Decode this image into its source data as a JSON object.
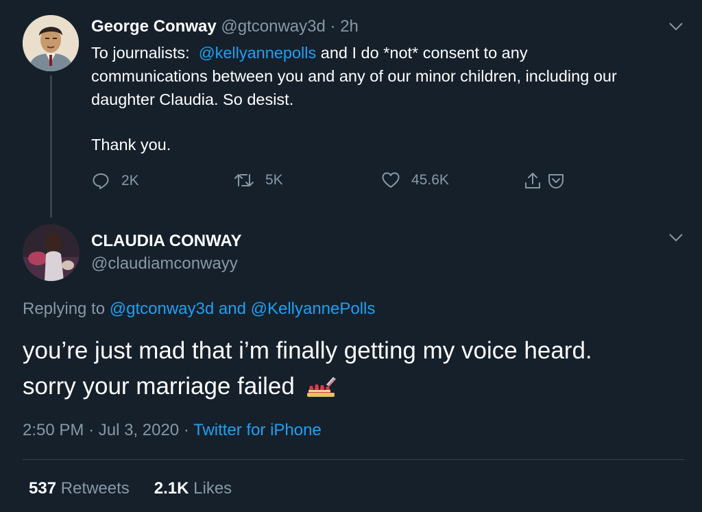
{
  "tweet1": {
    "author_name": "George Conway",
    "author_handle": "@gtconway3d",
    "separator": "·",
    "time": "2h",
    "text_line1_prefix": "To journalists:",
    "mention": "@kellyannepolls",
    "text_line1_suffix": "and I do *not* consent to any",
    "text_line2": "communications between you and any of our minor children, including our",
    "text_line3": "daughter Claudia.  So desist.",
    "text_line4": "Thank you.",
    "replies": "2K",
    "retweets": "5K",
    "likes": "45.6K"
  },
  "tweet2": {
    "author_name": "CLAUDIA CONWAY",
    "author_handle": "@claudiamconwayy",
    "replying_label": "Replying to",
    "replying_user1": "@gtconway3d",
    "replying_and": "and",
    "replying_user2": "@KellyannePolls",
    "text_line1": "you’re just mad that i’m finally getting my voice heard.",
    "text_line2": "sorry your marriage failed",
    "emoji": "lipstick-icon",
    "time": "2:50 PM",
    "date_separator": "·",
    "date": "Jul 3, 2020",
    "source_separator": "·",
    "source": "Twitter for iPhone",
    "retweet_count": "537",
    "retweet_label": "Retweets",
    "like_count": "2.1K",
    "like_label": "Likes"
  },
  "colors": {
    "background": "#15202b",
    "muted": "#8899a6",
    "link": "#1da1f2",
    "divider": "#38444d"
  }
}
